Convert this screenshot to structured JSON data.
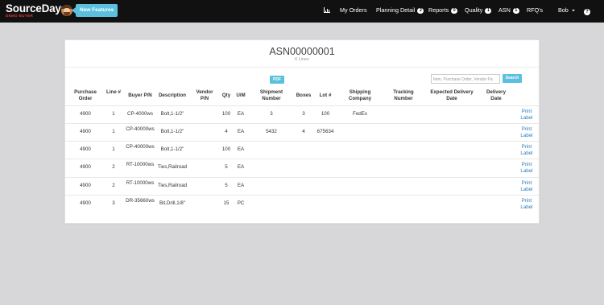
{
  "nav": {
    "brand": "SourceDay",
    "brand_tm": "™",
    "brand_sub": "DEMO BUYER",
    "new_features": "New Features",
    "items": [
      {
        "label": "",
        "icon": "bar-chart-icon"
      },
      {
        "label": "My Orders",
        "badge": ""
      },
      {
        "label": "Planning Detail",
        "badge": "2"
      },
      {
        "label": "Reports",
        "badge": "0"
      },
      {
        "label": "Quality",
        "badge": "1"
      },
      {
        "label": "ASN",
        "badge": "1"
      },
      {
        "label": "RFQ's",
        "badge": ""
      },
      {
        "label": "Bob",
        "badge": ""
      },
      {
        "label": "",
        "icon": "help-icon"
      }
    ]
  },
  "asn": {
    "title": "ASN00000001",
    "subtitle": "6 Lines",
    "pdf_label": "PDF",
    "search_placeholder": "Item, Purchase Order, Vendor Pa",
    "search_label": "Search"
  },
  "table": {
    "headers": {
      "po": "Purchase Order",
      "line": "Line #",
      "buyer_pn": "Buyer P/N",
      "description": "Description",
      "vendor_pn": "Vendor P/N",
      "qty": "Qty",
      "um": "U/M",
      "shipment": "Shipment Number",
      "boxes": "Boxes",
      "lot": "Lot #",
      "shipping_company": "Shipping Company",
      "tracking": "Tracking Number",
      "expected_delivery": "Expected Delivery Date",
      "delivery": "Delivery Date",
      "action": ""
    },
    "rows": [
      {
        "po": "4900",
        "line": "1",
        "buyer_pn": "CP-4000ws",
        "description": "Bolt,1-1/2\"",
        "vendor_pn": "",
        "qty": "100",
        "um": "EA",
        "shipment": "3",
        "boxes": "3",
        "lot": "100",
        "shipping_company": "FedEx",
        "tracking": "",
        "expected_delivery": "",
        "delivery": "",
        "action": "Print Label"
      },
      {
        "po": "4900",
        "line": "1",
        "buyer_pn": "CP-40000ws",
        "description": "Bolt,1-1/2\"",
        "vendor_pn": "",
        "qty": "4",
        "um": "EA",
        "shipment": "5432",
        "boxes": "4",
        "lot": "675634",
        "shipping_company": "",
        "tracking": "",
        "expected_delivery": "",
        "delivery": "",
        "action": "Print Label"
      },
      {
        "po": "4900",
        "line": "1",
        "buyer_pn": "CP-40000ws",
        "description": "Bolt,1-1/2\"",
        "vendor_pn": "",
        "qty": "100",
        "um": "EA",
        "shipment": "",
        "boxes": "",
        "lot": "",
        "shipping_company": "",
        "tracking": "",
        "expected_delivery": "",
        "delivery": "",
        "action": "Print Label"
      },
      {
        "po": "4900",
        "line": "2",
        "buyer_pn": "RT-10000ws",
        "description": "Ties,Railroad",
        "vendor_pn": "",
        "qty": "5",
        "um": "EA",
        "shipment": "",
        "boxes": "",
        "lot": "",
        "shipping_company": "",
        "tracking": "",
        "expected_delivery": "",
        "delivery": "",
        "action": "Print Label"
      },
      {
        "po": "4900",
        "line": "2",
        "buyer_pn": "RT-10000ws",
        "description": "Ties,Railroad",
        "vendor_pn": "",
        "qty": "5",
        "um": "EA",
        "shipment": "",
        "boxes": "",
        "lot": "",
        "shipping_company": "",
        "tracking": "",
        "expected_delivery": "",
        "delivery": "",
        "action": "Print Label"
      },
      {
        "po": "4900",
        "line": "3",
        "buyer_pn": "DR-35660ws",
        "description": "Bit,Drill,1/8\"",
        "vendor_pn": "",
        "qty": "15",
        "um": "PC",
        "shipment": "",
        "boxes": "",
        "lot": "",
        "shipping_company": "",
        "tracking": "",
        "expected_delivery": "",
        "delivery": "",
        "action": "Print Label"
      }
    ]
  }
}
